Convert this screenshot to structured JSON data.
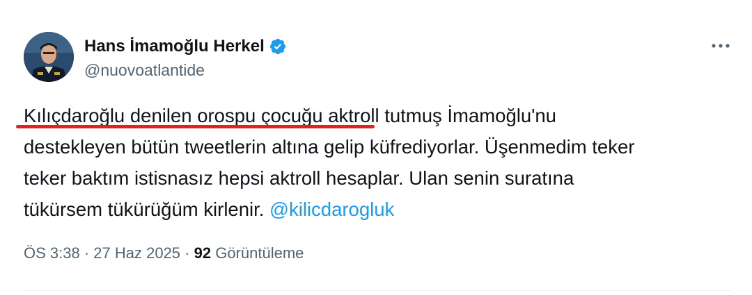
{
  "author": {
    "display_name": "Hans İmamoğlu Herkel",
    "handle": "@nuovoatlantide",
    "verified": true,
    "verified_color": "#1d9bf0"
  },
  "tweet": {
    "line1": "Kılıçdaroğlu denilen orospu çocuğu aktroll tutmuş İmamoğlu'nu",
    "line2": "destekleyen bütün tweetlerin altına gelip küfrediyorlar. Üşenmedim teker",
    "line3": "teker baktım istisnasız hepsi aktroll hesaplar. Ulan senin suratına",
    "line4_text": "tükürsem tükürüğüm kirlenir. ",
    "mention": "@kilicdarogluk",
    "highlight_color": "#e0241b"
  },
  "meta": {
    "time": "ÖS 3:38",
    "sep1": " · ",
    "date": "27 Haz 2025",
    "sep2": " · ",
    "views_count": "92",
    "views_label": " Görüntüleme"
  },
  "icons": {
    "more": "more-options-icon",
    "verified": "verified-badge-icon"
  }
}
